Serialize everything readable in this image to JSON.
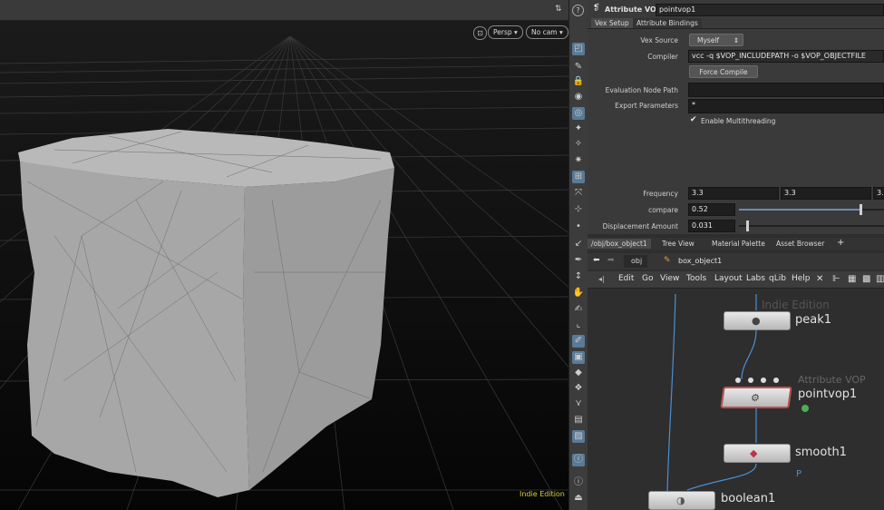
{
  "viewport": {
    "persp_label": "Persp",
    "cam_label": "No cam",
    "indie_label": "Indie Edition"
  },
  "parameters": {
    "node_type": "Attribute VOP",
    "node_name": "pointvop1",
    "tabs": [
      "Vex Setup",
      "Attribute Bindings"
    ],
    "vex_source_label": "Vex Source",
    "vex_source_value": "Myself",
    "compiler_label": "Compiler",
    "compiler_value": "vcc -q $VOP_INCLUDEPATH -o $VOP_OBJECTFILE",
    "force_compile_label": "Force Compile",
    "eval_node_path_label": "Evaluation Node Path",
    "eval_node_path_value": "",
    "export_params_label": "Export Parameters",
    "export_params_value": "*",
    "multithreading_label": "Enable Multithreading",
    "multithreading_checked": true,
    "frequency_label": "Frequency",
    "frequency_values": [
      "3.3",
      "3.3",
      "3."
    ],
    "compare_label": "compare",
    "compare_value": "0.52",
    "compare_level": 0.52,
    "displacement_label": "Displacement Amount",
    "displacement_value": "0.031",
    "displacement_level": 0.031
  },
  "network": {
    "tabs": [
      "/obj/box_object1",
      "Tree View",
      "Material Palette",
      "Asset Browser"
    ],
    "path": [
      "obj",
      "box_object1"
    ],
    "menu": [
      "Edit",
      "Go",
      "View",
      "Tools",
      "Layout",
      "Labs",
      "qLib",
      "Help"
    ],
    "watermark": "Indie Edition",
    "nodes": [
      {
        "name": "peak1"
      },
      {
        "name": "pointvop1",
        "type_label": "Attribute VOP"
      },
      {
        "name": "smooth1",
        "flag": "P"
      },
      {
        "name": "boolean1"
      }
    ]
  },
  "colors": {
    "accent": "#5a7a96",
    "indie": "#d8d23a",
    "wire": "#4a90d0"
  }
}
